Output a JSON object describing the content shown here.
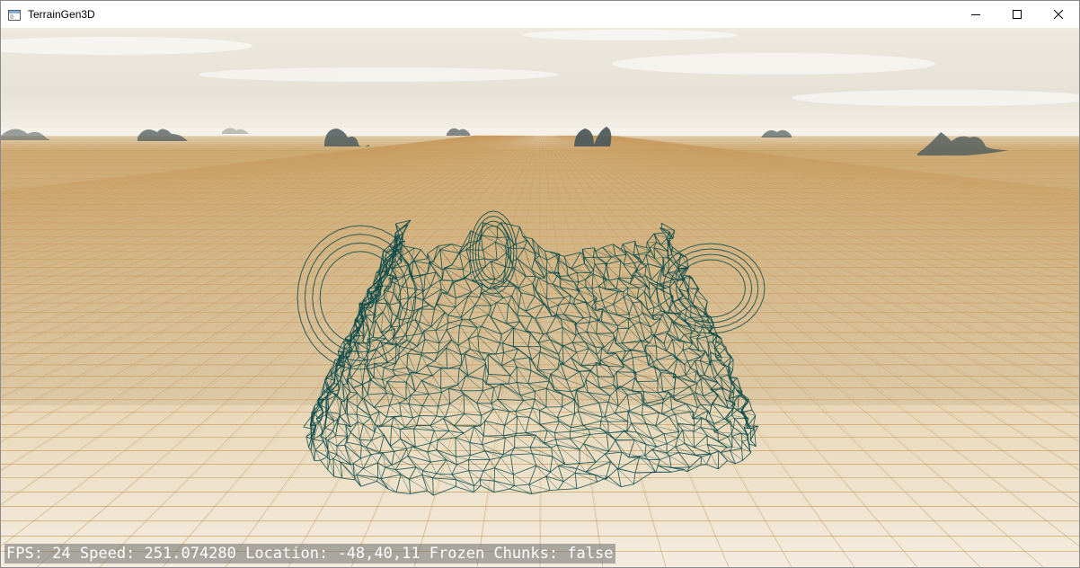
{
  "window": {
    "title": "TerrainGen3D",
    "icon": "app-window-icon",
    "controls": [
      "minimize-icon",
      "maximize-icon",
      "close-icon"
    ]
  },
  "scene": {
    "sky_colors": [
      "#f1ece2",
      "#e7e3da",
      "#f7f3ea"
    ],
    "ground_colors": [
      "#d2ac70",
      "#e6d2ac",
      "#f2ebdc"
    ],
    "wire_color": "#0b4a4a",
    "grid_color": "#c99a5e"
  },
  "hud": {
    "text": "FPS: 24 Speed: 251.074280 Location: -48,40,11 Frozen Chunks: false"
  }
}
